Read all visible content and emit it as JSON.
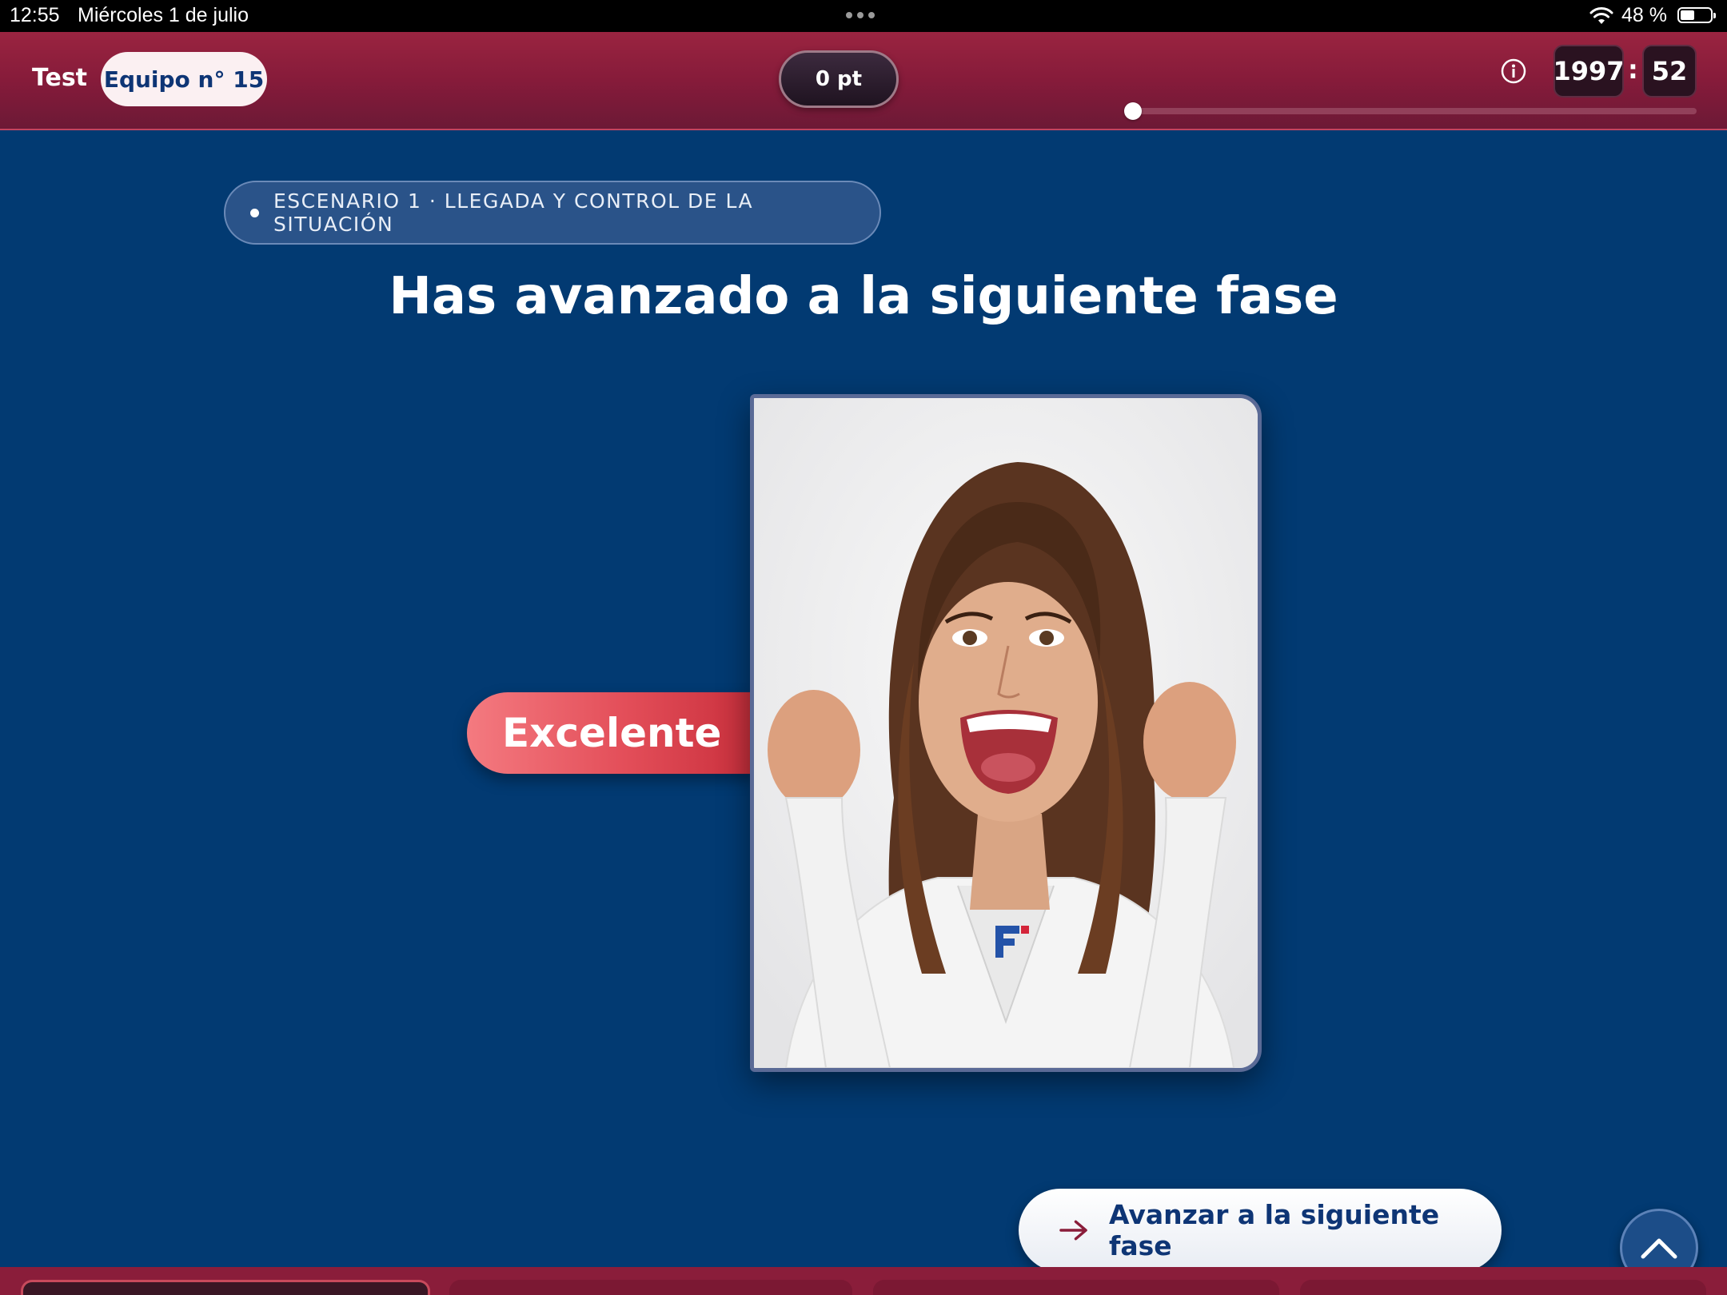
{
  "status_bar": {
    "time": "12:55",
    "date": "Miércoles 1 de julio",
    "battery": "48 %",
    "battery_level": 0.48,
    "wifi_icon": "wifi-icon",
    "battery_icon": "battery-icon"
  },
  "header": {
    "mode_label": "Test",
    "team_label": "Equipo n° 15",
    "points": "0 pt",
    "info_icon": "info-icon",
    "timer": {
      "minutes": "1997",
      "separator": ":",
      "seconds": "52"
    },
    "progress": 0.0
  },
  "main": {
    "scenario_label": "ESCENARIO 1 · LLEGADA Y CONTROL DE LA SITUACIÓN",
    "title": "Has avanzado a la siguiente fase",
    "rating": "Excelente",
    "next_button": {
      "label": "Avanzar a la siguiente fase",
      "icon": "arrow-right-icon"
    },
    "scroll_top_icon": "chevron-up-icon"
  },
  "colors": {
    "background": "#023a72",
    "header": "#861b3a",
    "accent_red": "#e34e59",
    "text_navy": "#0e3575"
  }
}
